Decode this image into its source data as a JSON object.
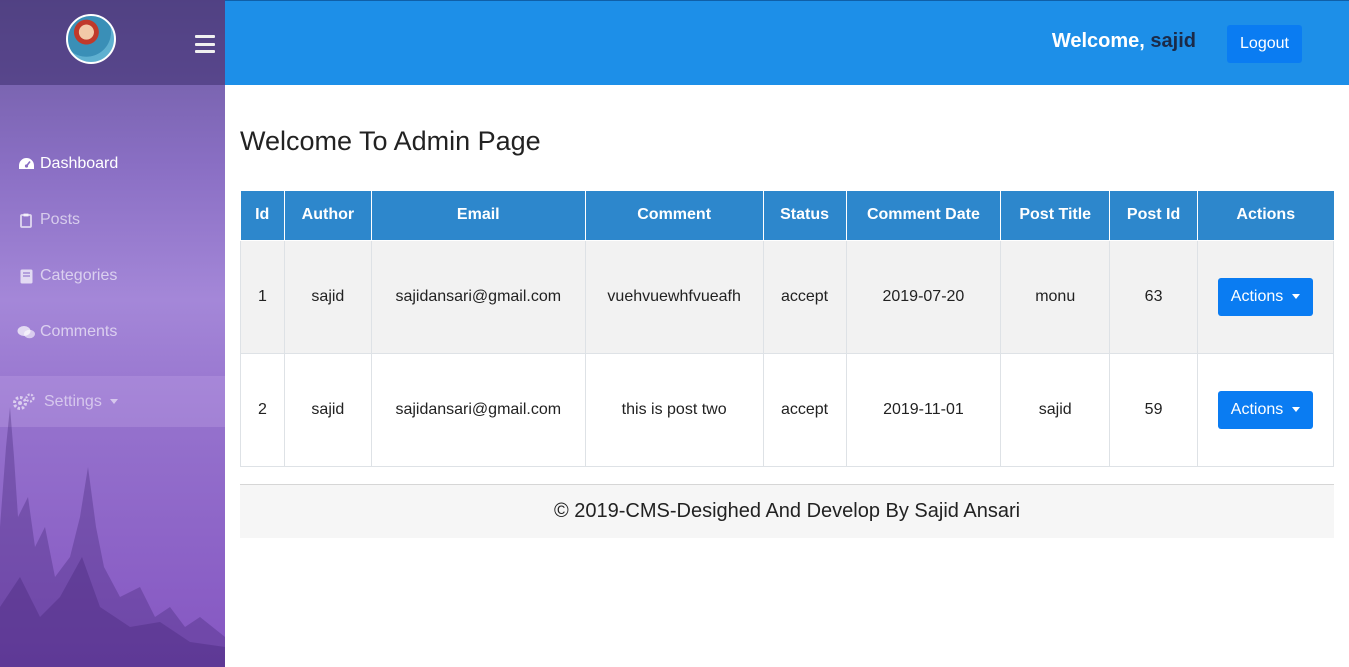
{
  "sidebar": {
    "items": [
      {
        "label": "Dashboard",
        "icon": "tachometer-icon"
      },
      {
        "label": "Posts",
        "icon": "clipboard-icon"
      },
      {
        "label": "Categories",
        "icon": "book-icon"
      },
      {
        "label": "Comments",
        "icon": "comments-icon"
      }
    ],
    "settings_label": "Settings"
  },
  "header": {
    "welcome_label": "Welcome,",
    "username": "sajid",
    "logout_label": "Logout",
    "color": "#1d8fe8"
  },
  "main": {
    "title": "Welcome To Admin Page",
    "table": {
      "columns": [
        "Id",
        "Author",
        "Email",
        "Comment",
        "Status",
        "Comment Date",
        "Post Title",
        "Post Id",
        "Actions"
      ],
      "rows": [
        {
          "id": "1",
          "author": "sajid",
          "email": "sajidansari@gmail.com",
          "comment": "vuehvuewhfvueafh",
          "status": "accept",
          "date": "2019-07-20",
          "post_title": "monu",
          "post_id": "63",
          "action_label": "Actions"
        },
        {
          "id": "2",
          "author": "sajid",
          "email": "sajidansari@gmail.com",
          "comment": "this is post two",
          "status": "accept",
          "date": "2019-11-01",
          "post_title": "sajid",
          "post_id": "59",
          "action_label": "Actions"
        }
      ]
    }
  },
  "footer": {
    "text": "© 2019-CMS-Desighed And Develop By Sajid Ansari"
  },
  "colors": {
    "accent": "#0a7cf2",
    "table_header": "#2d87cc",
    "sidebar": "#8a6fc4"
  }
}
